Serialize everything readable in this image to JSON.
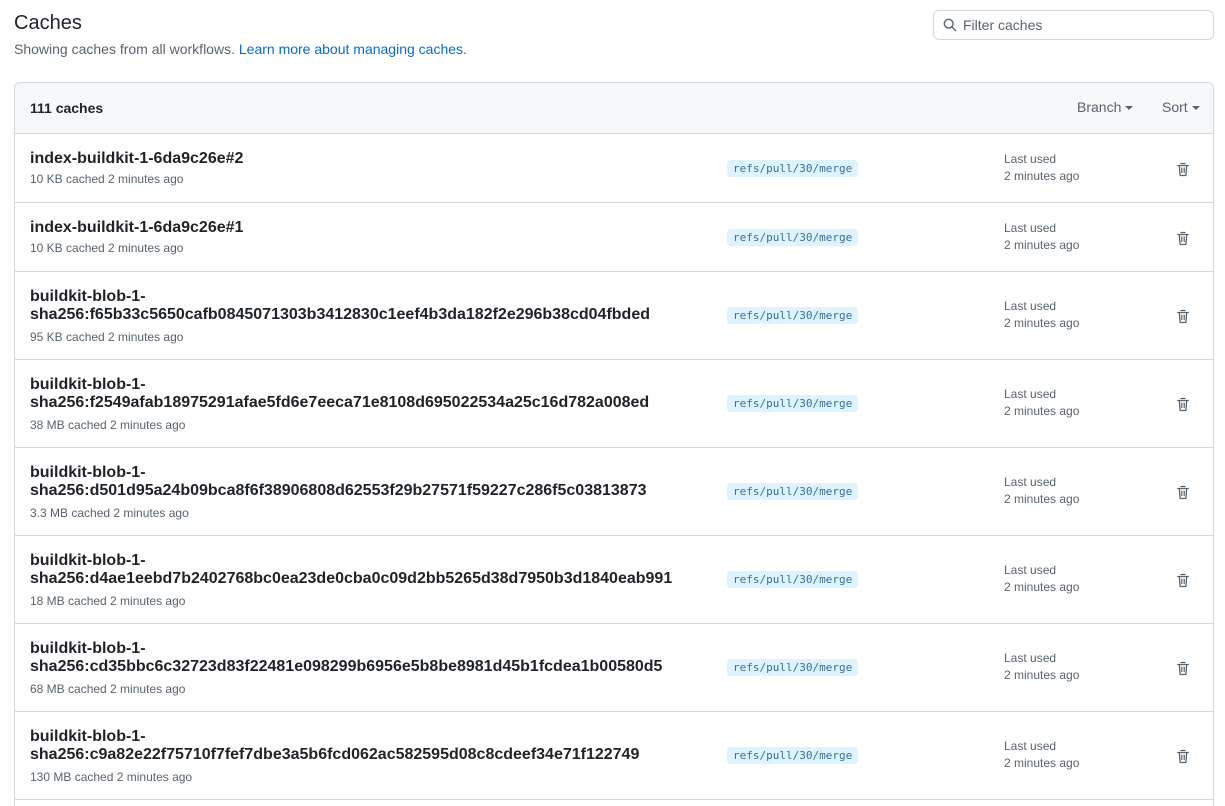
{
  "header": {
    "title": "Caches",
    "subtitle_text": "Showing caches from all workflows. ",
    "learn_more_link": "Learn more about managing caches."
  },
  "search": {
    "placeholder": "Filter caches",
    "value": "",
    "icon": "search-icon"
  },
  "list": {
    "count_label": "111 caches",
    "branch_filter_label": "Branch",
    "sort_label": "Sort",
    "last_used_label": "Last used",
    "delete_icon": "trash-icon",
    "rows": [
      {
        "name_lines": [
          "index-buildkit-1-6da9c26e#2"
        ],
        "meta": "10 KB cached 2 minutes ago",
        "branch": "refs/pull/30/merge",
        "last_used": "2 minutes ago"
      },
      {
        "name_lines": [
          "index-buildkit-1-6da9c26e#1"
        ],
        "meta": "10 KB cached 2 minutes ago",
        "branch": "refs/pull/30/merge",
        "last_used": "2 minutes ago"
      },
      {
        "name_lines": [
          "buildkit-blob-1-",
          "sha256:f65b33c5650cafb0845071303b3412830c1eef4b3da182f2e296b38cd04fbded"
        ],
        "meta": "95 KB cached 2 minutes ago",
        "branch": "refs/pull/30/merge",
        "last_used": "2 minutes ago"
      },
      {
        "name_lines": [
          "buildkit-blob-1-",
          "sha256:f2549afab18975291afae5fd6e7eeca71e8108d695022534a25c16d782a008ed"
        ],
        "meta": "38 MB cached 2 minutes ago",
        "branch": "refs/pull/30/merge",
        "last_used": "2 minutes ago"
      },
      {
        "name_lines": [
          "buildkit-blob-1-",
          "sha256:d501d95a24b09bca8f6f38906808d62553f29b27571f59227c286f5c03813873"
        ],
        "meta": "3.3 MB cached 2 minutes ago",
        "branch": "refs/pull/30/merge",
        "last_used": "2 minutes ago"
      },
      {
        "name_lines": [
          "buildkit-blob-1-",
          "sha256:d4ae1eebd7b2402768bc0ea23de0cba0c09d2bb5265d38d7950b3d1840eab991"
        ],
        "meta": "18 MB cached 2 minutes ago",
        "branch": "refs/pull/30/merge",
        "last_used": "2 minutes ago"
      },
      {
        "name_lines": [
          "buildkit-blob-1-",
          "sha256:cd35bbc6c32723d83f22481e098299b6956e5b8be8981d45b1fcdea1b00580d5"
        ],
        "meta": "68 MB cached 2 minutes ago",
        "branch": "refs/pull/30/merge",
        "last_used": "2 minutes ago"
      },
      {
        "name_lines": [
          "buildkit-blob-1-",
          "sha256:c9a82e22f75710f7fef7dbe3a5b6fcd062ac582595d08c8cdeef34e71f122749"
        ],
        "meta": "130 MB cached 2 minutes ago",
        "branch": "refs/pull/30/merge",
        "last_used": "2 minutes ago"
      }
    ]
  }
}
